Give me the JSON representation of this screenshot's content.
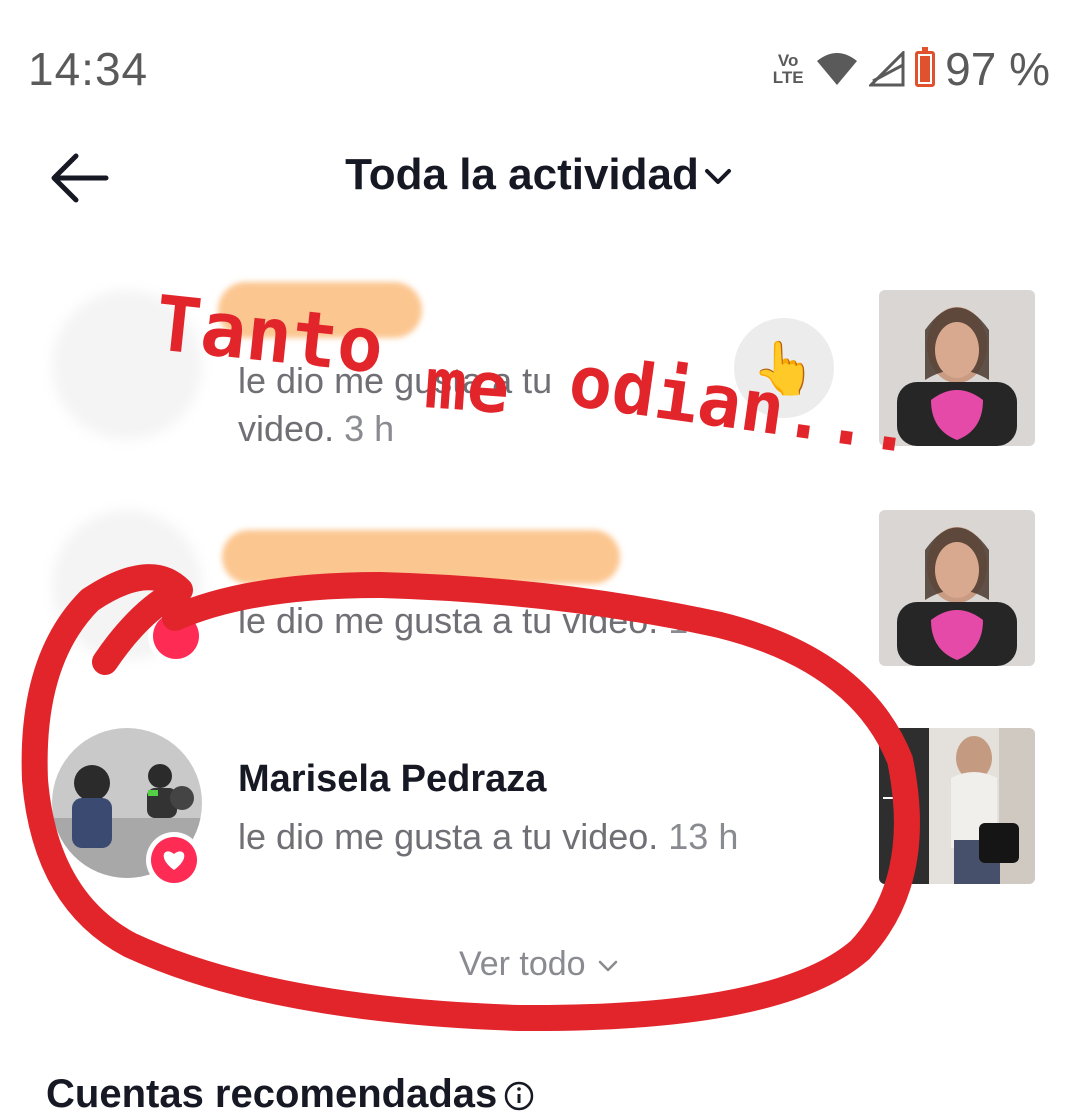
{
  "status_bar": {
    "time": "14:34",
    "volte_top": "Vo",
    "volte_bottom": "LTE",
    "battery_percent": "97 %",
    "icons": [
      "wifi-icon",
      "signal-icon",
      "battery-charging-icon"
    ]
  },
  "header": {
    "title": "Toda la actividad",
    "back_icon": "arrow-left-icon",
    "dropdown_icon": "chevron-down-icon"
  },
  "activity": {
    "rows": [
      {
        "name": "",
        "text": "le dio me gusta a tu",
        "text_line2": "video.",
        "time": "3 h"
      },
      {
        "name": "",
        "text": "le dio me gusta a tu video.",
        "time": "13"
      },
      {
        "name": "Marisela Pedraza",
        "text": "le dio me gusta a tu video.",
        "time": "13 h"
      }
    ],
    "see_all": "Ver todo"
  },
  "recommended": {
    "title": "Cuentas recomendadas"
  },
  "annotation": {
    "word1": "Tanto",
    "word2": "me",
    "word3": "odian...",
    "emoji": "👆",
    "color": "#e2252b"
  }
}
